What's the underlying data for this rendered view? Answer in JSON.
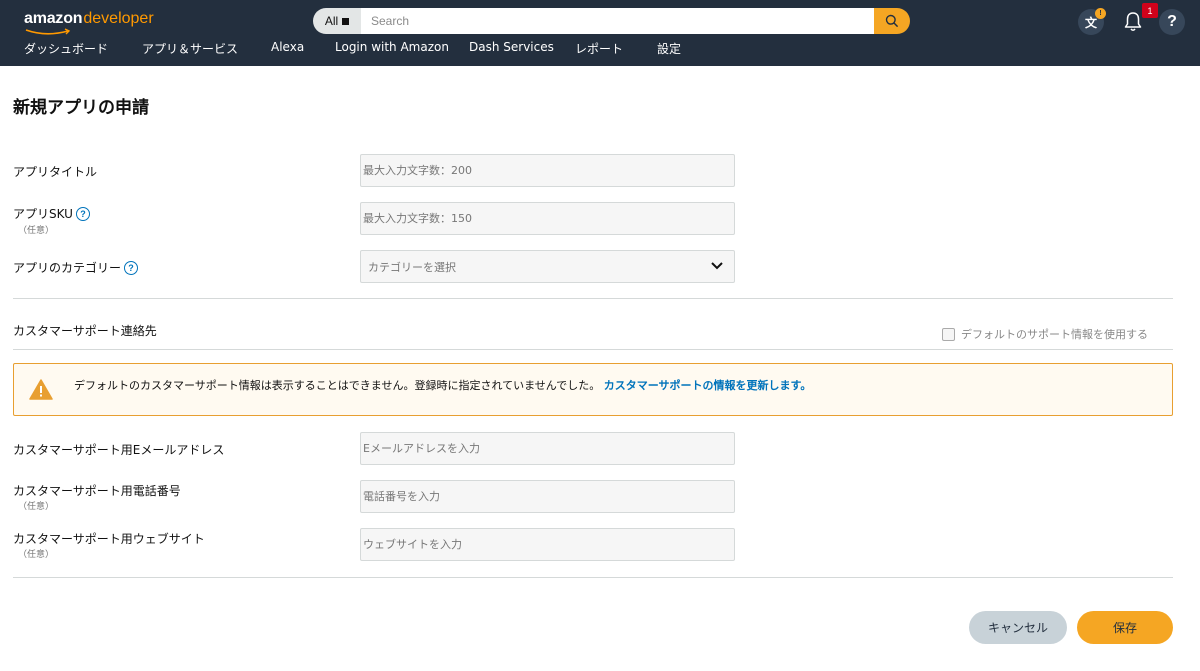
{
  "header": {
    "logo_amazon": "amazon",
    "logo_developer": "developer",
    "search_scope": "All",
    "search_placeholder": "Search",
    "lang_icon_glyph": "文",
    "lang_badge": "!",
    "notification_count": "1",
    "help_glyph": "?"
  },
  "nav": {
    "items": [
      {
        "label": "ダッシュボード"
      },
      {
        "label": "アプリ＆サービス"
      },
      {
        "label": "Alexa"
      },
      {
        "label": "Login with Amazon"
      },
      {
        "label": "Dash Services"
      },
      {
        "label": "レポート"
      },
      {
        "label": "設定"
      }
    ]
  },
  "form": {
    "title": "新規アプリの申請",
    "app_title": {
      "label": "アプリタイトル",
      "placeholder": "最大入力文字数：200"
    },
    "app_sku": {
      "label": "アプリSKU",
      "optional": "（任意）",
      "placeholder": "最大入力文字数：150"
    },
    "category": {
      "label": "アプリのカテゴリー",
      "placeholder": "カテゴリーを選択"
    },
    "support_section": "カスタマーサポート連絡先",
    "use_default_support": "デフォルトのサポート情報を使用する",
    "alert": {
      "text": "デフォルトのカスタマーサポート情報は表示することはできません。登録時に指定されていませんでした。",
      "link": "カスタマーサポートの情報を更新します。"
    },
    "support_email": {
      "label": "カスタマーサポート用Eメールアドレス",
      "placeholder": "Eメールアドレスを入力"
    },
    "support_phone": {
      "label": "カスタマーサポート用電話番号",
      "optional": "（任意）",
      "placeholder": "電話番号を入力"
    },
    "support_website": {
      "label": "カスタマーサポート用ウェブサイト",
      "optional": "（任意）",
      "placeholder": "ウェブサイトを入力"
    },
    "cancel_label": "キャンセル",
    "save_label": "保存"
  },
  "colors": {
    "header_bg": "#232f3e",
    "accent": "#f5a623",
    "link": "#0073bb",
    "badge_red": "#d0021b"
  },
  "icons": [
    "search-icon",
    "language-icon",
    "bell-icon",
    "help-icon",
    "chevron-down-icon",
    "warning-icon",
    "help-circle-icon"
  ]
}
